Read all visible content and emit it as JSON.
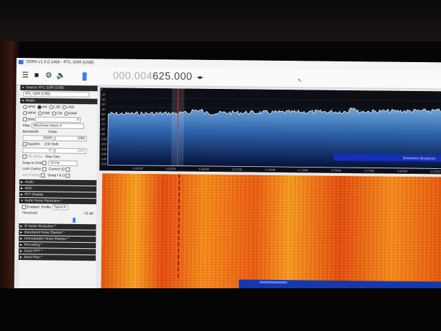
{
  "window": {
    "title": "SDR# v1.0.0.1466 - RTL-SDR (USB)"
  },
  "toolbar": {
    "frequency_dim": "000.004",
    "frequency_main": "625.000",
    "frequency_sep": ".",
    "arrows": "◂▸"
  },
  "panel": {
    "source_header": "Source: RTL-SDR (USB)",
    "source_value": "RTL-SDR (USB)",
    "radio_header": "Radio",
    "modes_row1": [
      "NFM",
      "AM",
      "LSB",
      "USB"
    ],
    "modes_row2": [
      "WFM",
      "DSB",
      "CW",
      "RAW"
    ],
    "selected_mode": "AM",
    "shift_label": "Shift",
    "shift_value": "0",
    "filter_label": "Filter",
    "filter_value": "Blackman-Harris 4",
    "bandwidth_label": "Bandwidth",
    "bandwidth_value": "10000",
    "order_label": "Order",
    "order_value": "1000",
    "squelch_label": "Squelch",
    "cw_shift_label": "CW Shift",
    "squelch_value": "50",
    "cw_shift_value": "1000",
    "fm_stereo_label": "FM Stereo",
    "step_size_label": "Step Size",
    "snap_label": "Snap to Grid",
    "step_value": "10 Hz",
    "lock_carrier_label": "Lock Carrier",
    "correct_iq_label": "Correct IQ",
    "anti_fading_label": "Anti-Fading",
    "swap_iq_label": "Swap I & Q",
    "audio_header": "Audio",
    "agc_header": "AGC",
    "fft_header": "FFT Display",
    "anr_header": "Audio Noise Reduction *",
    "anr_enabled_label": "Enabled",
    "anr_profile_label": "Profile",
    "anr_profile_value": "Speech",
    "anr_threshold_label": "Threshold",
    "anr_threshold_value": "-70 dB",
    "plugins": [
      "IF Noise Reduction *",
      "Baseband Noise Blanker *",
      "Demodulator Noise Blanker *",
      "Recording *",
      "Zoom FFT *",
      "Band Plan *"
    ]
  },
  "spectrum": {
    "y_ticks": [
      "0",
      "-10",
      "-20",
      "-30",
      "-40",
      "-50",
      "-60",
      "-70",
      "-80",
      "-90",
      "-100",
      "-110",
      "-120",
      "-130",
      "-140",
      "-150"
    ],
    "x_ticks": [
      "4.600M",
      "4.625M",
      "4.650M",
      "4.675M",
      "4.700M",
      "4.725M",
      "4.750M",
      "4.775M",
      "4.800M",
      "4.825M"
    ],
    "band_label": "Shortwave Broadcast",
    "band_color": "#1330b8",
    "tuned_marker_color": "#ff2020"
  }
}
